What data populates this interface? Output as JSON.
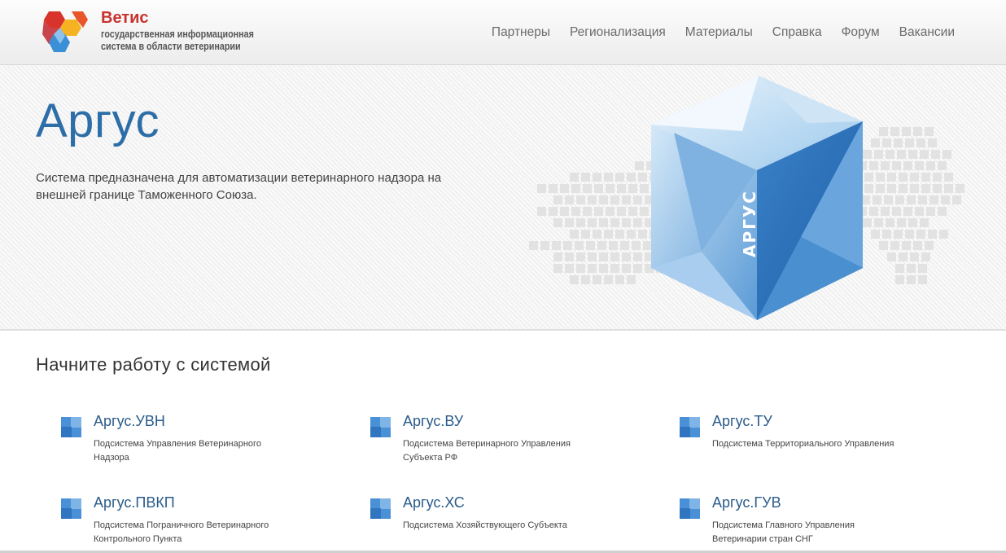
{
  "brand": {
    "title": "Ветис",
    "subtitle": "государственная информационная система в области ветеринарии"
  },
  "nav": {
    "items": [
      "Партнеры",
      "Регионализация",
      "Материалы",
      "Справка",
      "Форум",
      "Вакансии"
    ]
  },
  "hero": {
    "title": "Аргус",
    "description": "Система предназначена для автоматизации ветеринарного надзора на внешней границе Таможенного Союза.",
    "cube_label": "АРГУС"
  },
  "start": {
    "title": "Начните работу с системой",
    "cards": [
      {
        "name": "Аргус.УВН",
        "desc": "Подсистема Управления Ветеринарного Надзора"
      },
      {
        "name": "Аргус.ВУ",
        "desc": "Подсистема Ветеринарного Управления Субъекта РФ"
      },
      {
        "name": "Аргус.ТУ",
        "desc": "Подсистема Территориального Управления"
      },
      {
        "name": "Аргус.ПВКП",
        "desc": "Подсистема Пограничного Ветеринарного Контрольного Пункта"
      },
      {
        "name": "Аргус.ХС",
        "desc": "Подсистема Хозяйствующего Субъекта"
      },
      {
        "name": "Аргус.ГУВ",
        "desc": "Подсистема Главного Управления Ветеринарии стран СНГ"
      }
    ]
  },
  "colors": {
    "brand_red": "#c8332e",
    "title_blue": "#2d6ea8",
    "link_blue": "#2a5c8a"
  }
}
